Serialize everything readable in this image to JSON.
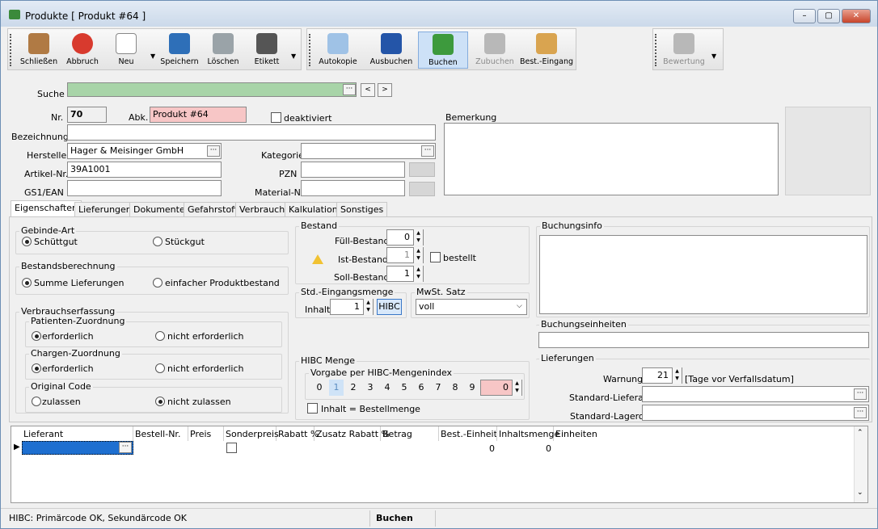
{
  "window": {
    "title": "Produkte [ Produkt #64 ]",
    "min": "–",
    "max": "▢",
    "close": "✕"
  },
  "toolbar": {
    "close": "Schließen",
    "cancel": "Abbruch",
    "new": "Neu",
    "save": "Speichern",
    "delete": "Löschen",
    "label": "Etikett",
    "autocopy": "Autokopie",
    "ausbuchen": "Ausbuchen",
    "buchen": "Buchen",
    "zubuchen": "Zubuchen",
    "bestEingang": "Best.-Eingang",
    "bewertung": "Bewertung"
  },
  "search": {
    "label": "Suche",
    "prev": "<",
    "next": ">"
  },
  "header": {
    "nr_label": "Nr.",
    "nr": "70",
    "abk_label": "Abk.",
    "abk": "Produkt #64",
    "deaktiviert": "deaktiviert",
    "bemerkung": "Bemerkung",
    "bezeichnung_label": "Bezeichnung",
    "bezeichnung": "",
    "hersteller_label": "Hersteller",
    "hersteller": "Hager & Meisinger GmbH",
    "kategorie_label": "Kategorie",
    "kategorie": "",
    "artikel_label": "Artikel-Nr.",
    "artikel": "39A1001",
    "pzn_label": "PZN",
    "pzn": "",
    "gs1_label": "GS1/EAN",
    "gs1": "",
    "material_label": "Material-Nr.",
    "material": ""
  },
  "tabs": [
    "Eigenschaften",
    "Lieferungen",
    "Dokumente",
    "Gefahrstoff",
    "Verbrauch",
    "Kalkulation",
    "Sonstiges"
  ],
  "gebinde": {
    "title": "Gebinde-Art",
    "opt1": "Schüttgut",
    "opt2": "Stückgut"
  },
  "bestandsber": {
    "title": "Bestandsberechnung",
    "opt1": "Summe Lieferungen",
    "opt2": "einfacher Produktbestand"
  },
  "verbrauch": {
    "title": "Verbrauchserfassung",
    "patient": "Patienten-Zuordnung",
    "charge": "Chargen-Zuordnung",
    "original": "Original Code",
    "erf": "erforderlich",
    "nerf": "nicht erforderlich",
    "zul": "zulassen",
    "nzul": "nicht zulassen"
  },
  "bestand": {
    "title": "Bestand",
    "fuell_label": "Füll-Bestand",
    "fuell": "0",
    "ist_label": "Ist-Bestand",
    "ist": "1",
    "soll_label": "Soll-Bestand",
    "soll": "1",
    "bestellt": "bestellt"
  },
  "eingang": {
    "title": "Std.-Eingangsmenge",
    "inhalt_label": "Inhalt",
    "inhalt": "1",
    "hibc": "HIBC"
  },
  "mwst": {
    "title": "MwSt. Satz",
    "value": "voll"
  },
  "hibc": {
    "title": "HIBC Menge",
    "vorgabe": "Vorgabe per HIBC-Mengenindex",
    "digits": [
      "0",
      "1",
      "2",
      "3",
      "4",
      "5",
      "6",
      "7",
      "8",
      "9"
    ],
    "value": "0",
    "inhaltBest": "Inhalt = Bestellmenge"
  },
  "buchungsinfo": {
    "title": "Buchungsinfo"
  },
  "einheiten": {
    "title": "Buchungseinheiten"
  },
  "lieferungen": {
    "title": "Lieferungen",
    "warnung_label": "Warnung",
    "warnung": "21",
    "tage": "[Tage vor Verfallsdatum]",
    "stdLief": "Standard-Lieferant",
    "stdLager": "Standard-Lagerort"
  },
  "grid": {
    "cols": [
      "Lieferant",
      "Bestell-Nr.",
      "Preis",
      "Sonderpreis",
      "Rabatt %",
      "Zusatz Rabatt %",
      "Betrag",
      "Best.-Einheit...",
      "Inhaltsmenge",
      "Einheiten"
    ],
    "row": {
      "best": "0",
      "inhalt": "0"
    }
  },
  "status": {
    "msg": "HIBC: Primärcode OK, Sekundärcode OK",
    "mode": "Buchen"
  }
}
